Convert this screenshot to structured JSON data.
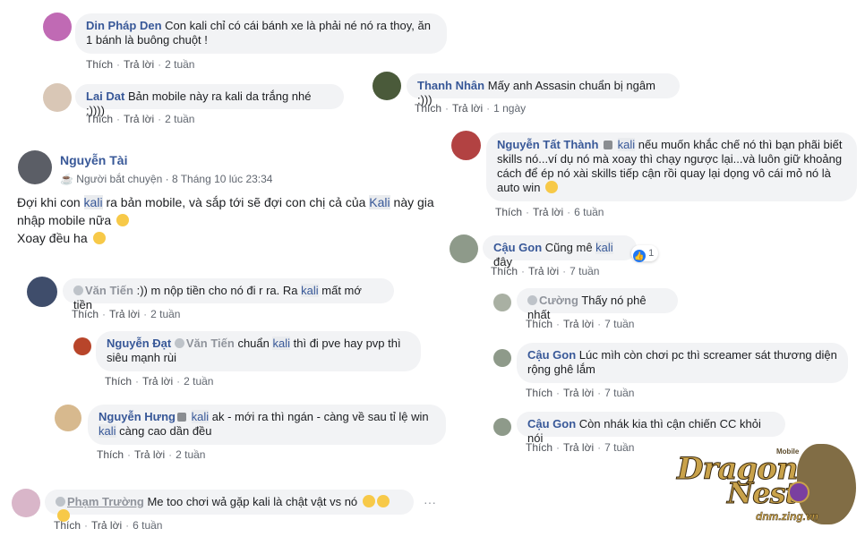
{
  "actions": {
    "like": "Thích",
    "reply": "Trả lời"
  },
  "comments": {
    "c1": {
      "author": "Din Pháp Den",
      "text": "Con kali chỉ có cái bánh xe là phải né nó ra thoy, ăn 1 bánh là buông chuột !",
      "time": "2 tuần"
    },
    "c2": {
      "author": "Lai Dat",
      "text": "Bản mobile này ra kali da trắng nhé :))))",
      "time": "2 tuần"
    },
    "c3": {
      "author": "Thanh Nhân",
      "text": "Mấy anh Assasin chuẩn bị ngâm :)))",
      "time": "1 ngày"
    },
    "c4": {
      "author": "Nguyễn Tất Thành",
      "tag": "kali",
      "text": "nếu muốn khắc chế nó thì bạn phãi biết skills nó...ví dụ nó mà xoay thì chạy ngược lại...và luôn giữ khoảng cách để ép nó xài skills tiếp cận rồi quay lại dọng vô cái mỏ nó là auto win",
      "time": "6 tuần"
    },
    "c5": {
      "author": "Cậu Gon",
      "text_before": "Cũng mê",
      "tag": "kali",
      "text_after": "đây",
      "reactions": "1",
      "time": "7 tuần"
    },
    "c6": {
      "author": "Cường",
      "text": "Thấy nó phê nhất",
      "time": "7 tuần"
    },
    "c7": {
      "author": "Cậu Gon",
      "text": "Lúc mìh còn chơi pc thì screamer sát thương diện rộng ghê lắm",
      "time": "7 tuần"
    },
    "c8": {
      "author": "Cậu Gon",
      "text": "Còn nhák kia thì cận chiến CC khỏi nói",
      "time": "7 tuần"
    },
    "c9": {
      "author": "Văn Tiến",
      "text_before": ":)) m nộp tiền cho nó đi r ra. Ra",
      "tag": "kali",
      "text_after": "mất mớ tiền",
      "time": "2 tuần"
    },
    "c10": {
      "author": "Nguyễn Đạt",
      "mention": "Văn Tiến",
      "text_before": "chuẩn",
      "tag": "kali",
      "text_after": "thì đi pve hay pvp thì siêu mạnh rùi",
      "time": "2 tuần"
    },
    "c11": {
      "author": "Nguyễn Hưng",
      "tag": "kali",
      "text_line1": "ak - mới ra thì ngán - càng về sau tỉ lệ win",
      "tag2": "kali",
      "text_line2": "càng cao dần đều",
      "time": "2 tuần"
    },
    "c12": {
      "author": "Phạm Trường",
      "text": "Me too chơi wả gặp kali là chật vật vs nó",
      "more": "···",
      "time": "6 tuần"
    }
  },
  "post": {
    "author": "Nguyễn Tài",
    "role": "Người bắt chuyện",
    "date": "8 Tháng 10 lúc 23:34",
    "line1_before": "Đợi khi con",
    "tag1": "kali",
    "line1_mid": "ra bản mobile, và sắp tới sẽ đợi con chị cả của",
    "tag2": "Kali",
    "line1_after": "này gia",
    "line2": "nhập mobile nữa",
    "line3": "Xoay đều ha"
  },
  "logo": {
    "title1": "Dragon",
    "title2": "Nest",
    "badge": "Mobile",
    "site": "dnm.zing.vn"
  },
  "colors": {
    "author": "#385898",
    "bubble": "#f2f3f5",
    "meta": "#616770",
    "like": "#2078f4"
  }
}
